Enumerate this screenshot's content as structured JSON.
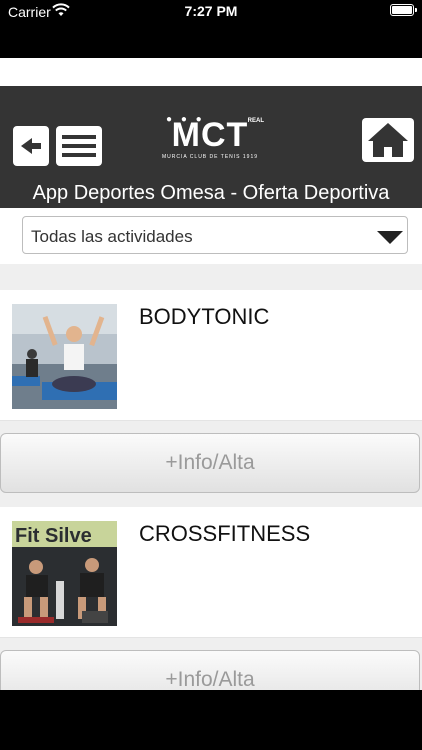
{
  "status": {
    "carrier": "Carrier",
    "time": "7:27 PM"
  },
  "header": {
    "logo_text": "MCT",
    "logo_real": "REAL",
    "logo_sub": "MURCIA CLUB DE TENIS 1919",
    "title": "App Deportes Omesa - Oferta Deportiva"
  },
  "filter": {
    "selected": "Todas las actividades"
  },
  "activities": [
    {
      "name": "BODYTONIC",
      "button_label": "+Info/Alta"
    },
    {
      "name": "CROSSFITNESS",
      "button_label": "+Info/Alta"
    }
  ],
  "colors": {
    "header_bg": "#343434",
    "page_bg": "#efefef"
  }
}
